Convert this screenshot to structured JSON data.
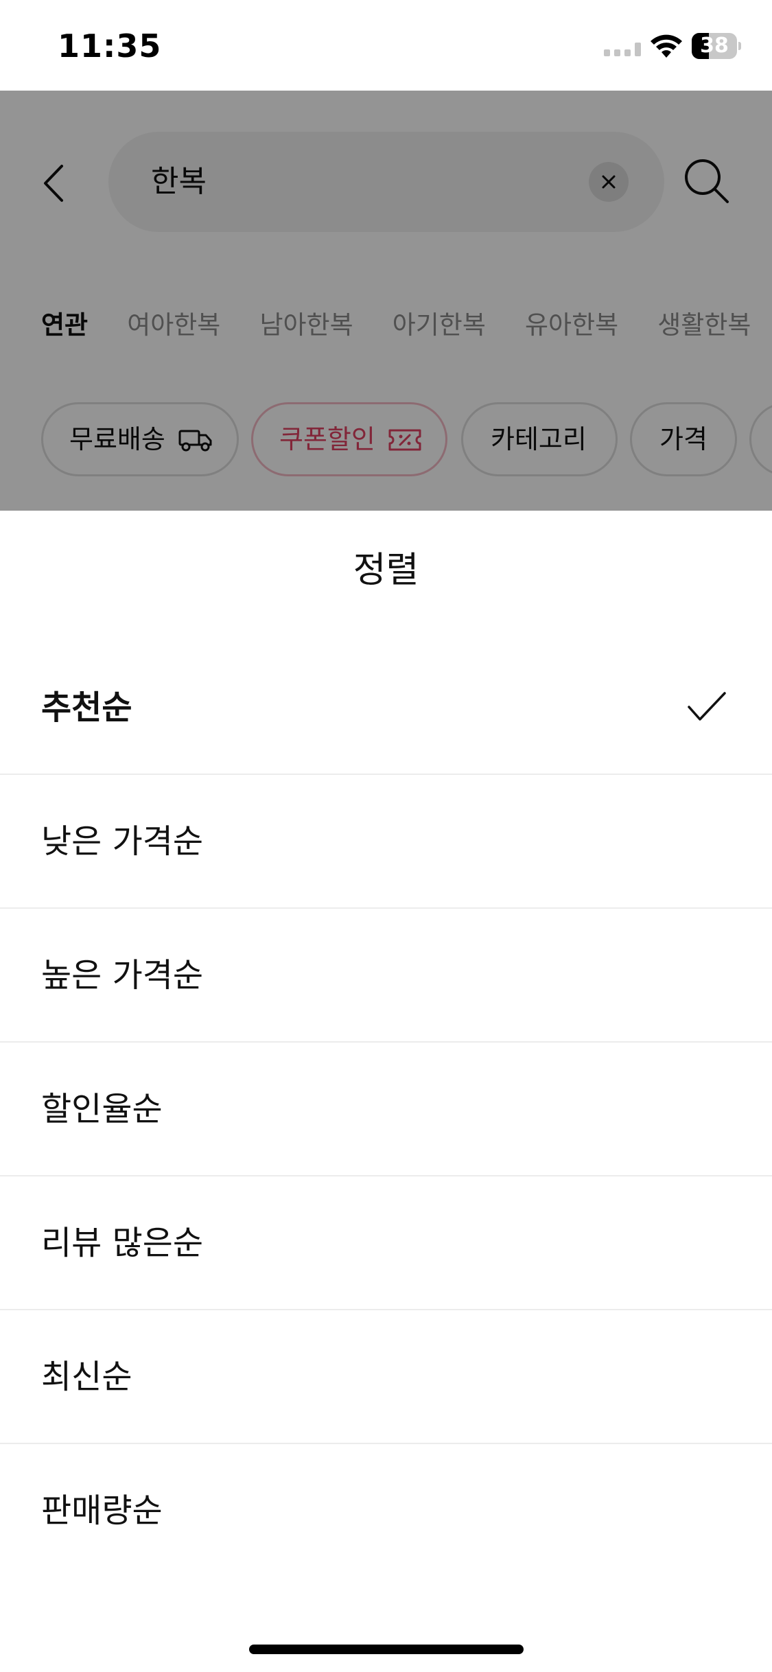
{
  "status_bar": {
    "time": "11:35",
    "battery_level": "38",
    "battery_fraction": 0.38
  },
  "search": {
    "query": "한복",
    "back_icon": "chevron-left-icon",
    "clear_icon": "close-icon",
    "search_icon": "search-icon"
  },
  "keywords": [
    {
      "label": "연관",
      "active": true
    },
    {
      "label": "여아한복",
      "active": false
    },
    {
      "label": "남아한복",
      "active": false
    },
    {
      "label": "아기한복",
      "active": false
    },
    {
      "label": "유아한복",
      "active": false
    },
    {
      "label": "생활한복",
      "active": false
    }
  ],
  "filter_chips": [
    {
      "label": "무료배송",
      "icon": "truck-icon"
    },
    {
      "label": "쿠폰할인",
      "icon": "coupon-icon",
      "accent": "#e04363"
    },
    {
      "label": "카테고리"
    },
    {
      "label": "가격"
    }
  ],
  "sort_sheet": {
    "title": "정렬",
    "options": [
      {
        "label": "추천순",
        "selected": true
      },
      {
        "label": "낮은 가격순",
        "selected": false
      },
      {
        "label": "높은 가격순",
        "selected": false
      },
      {
        "label": "할인율순",
        "selected": false
      },
      {
        "label": "리뷰 많은순",
        "selected": false
      },
      {
        "label": "최신순",
        "selected": false
      },
      {
        "label": "판매량순",
        "selected": false
      }
    ],
    "selected_icon": "checkmark-icon"
  },
  "colors": {
    "accent": "#e04363",
    "overlay": "rgba(0,0,0,0.42)"
  }
}
